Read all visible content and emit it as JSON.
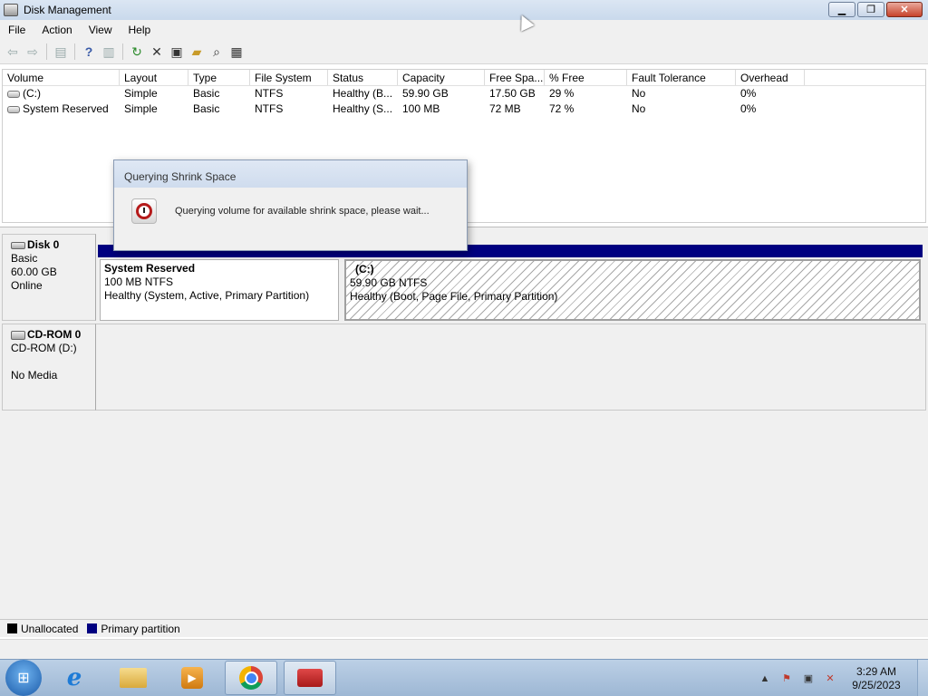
{
  "window": {
    "title": "Disk Management",
    "min": "▁",
    "max": "❐",
    "close": "✕"
  },
  "menu": [
    "File",
    "Action",
    "View",
    "Help"
  ],
  "toolbar": {
    "icons": [
      "back-icon",
      "forward-icon",
      "console-tree-icon",
      "help-icon",
      "show-hide-icon",
      "refresh-icon",
      "delete-icon",
      "properties-icon",
      "open-icon",
      "explore-icon",
      "settings-icon"
    ]
  },
  "volume_list": {
    "columns": [
      "Volume",
      "Layout",
      "Type",
      "File System",
      "Status",
      "Capacity",
      "Free Spa...",
      "% Free",
      "Fault Tolerance",
      "Overhead"
    ],
    "rows": [
      [
        "(C:)",
        "Simple",
        "Basic",
        "NTFS",
        "Healthy (B...",
        "59.90 GB",
        "17.50 GB",
        "29 %",
        "No",
        "0%"
      ],
      [
        "System Reserved",
        "Simple",
        "Basic",
        "NTFS",
        "Healthy (S...",
        "100 MB",
        "72 MB",
        "72 %",
        "No",
        "0%"
      ]
    ]
  },
  "disks": {
    "disk0": {
      "name": "Disk 0",
      "type": "Basic",
      "size": "60.00 GB",
      "state": "Online",
      "partitions": {
        "system_reserved": {
          "name": "System Reserved",
          "size": "100 MB NTFS",
          "status": "Healthy (System, Active, Primary Partition)"
        },
        "c": {
          "name": "(C:)",
          "size": "59.90 GB NTFS",
          "status": "Healthy (Boot, Page File, Primary Partition)"
        }
      }
    },
    "cdrom0": {
      "name": "CD-ROM 0",
      "drive": "CD-ROM (D:)",
      "media": "No Media"
    }
  },
  "legend": {
    "unallocated": "Unallocated",
    "primary": "Primary partition",
    "unallocated_color": "#000000",
    "primary_color": "#000080"
  },
  "dialog": {
    "title": "Querying Shrink Space",
    "message": "Querying volume for available shrink space, please wait..."
  },
  "taskbar": {
    "apps": [
      "internet-explorer-icon",
      "windows-explorer-icon",
      "media-player-icon",
      "chrome-icon",
      "disk-management-icon"
    ],
    "tray_arrow": "▲",
    "time": "3:29 AM",
    "date": "9/25/2023"
  },
  "colors": {
    "accent": "#000080",
    "title_bar": "#dbe6f3"
  }
}
